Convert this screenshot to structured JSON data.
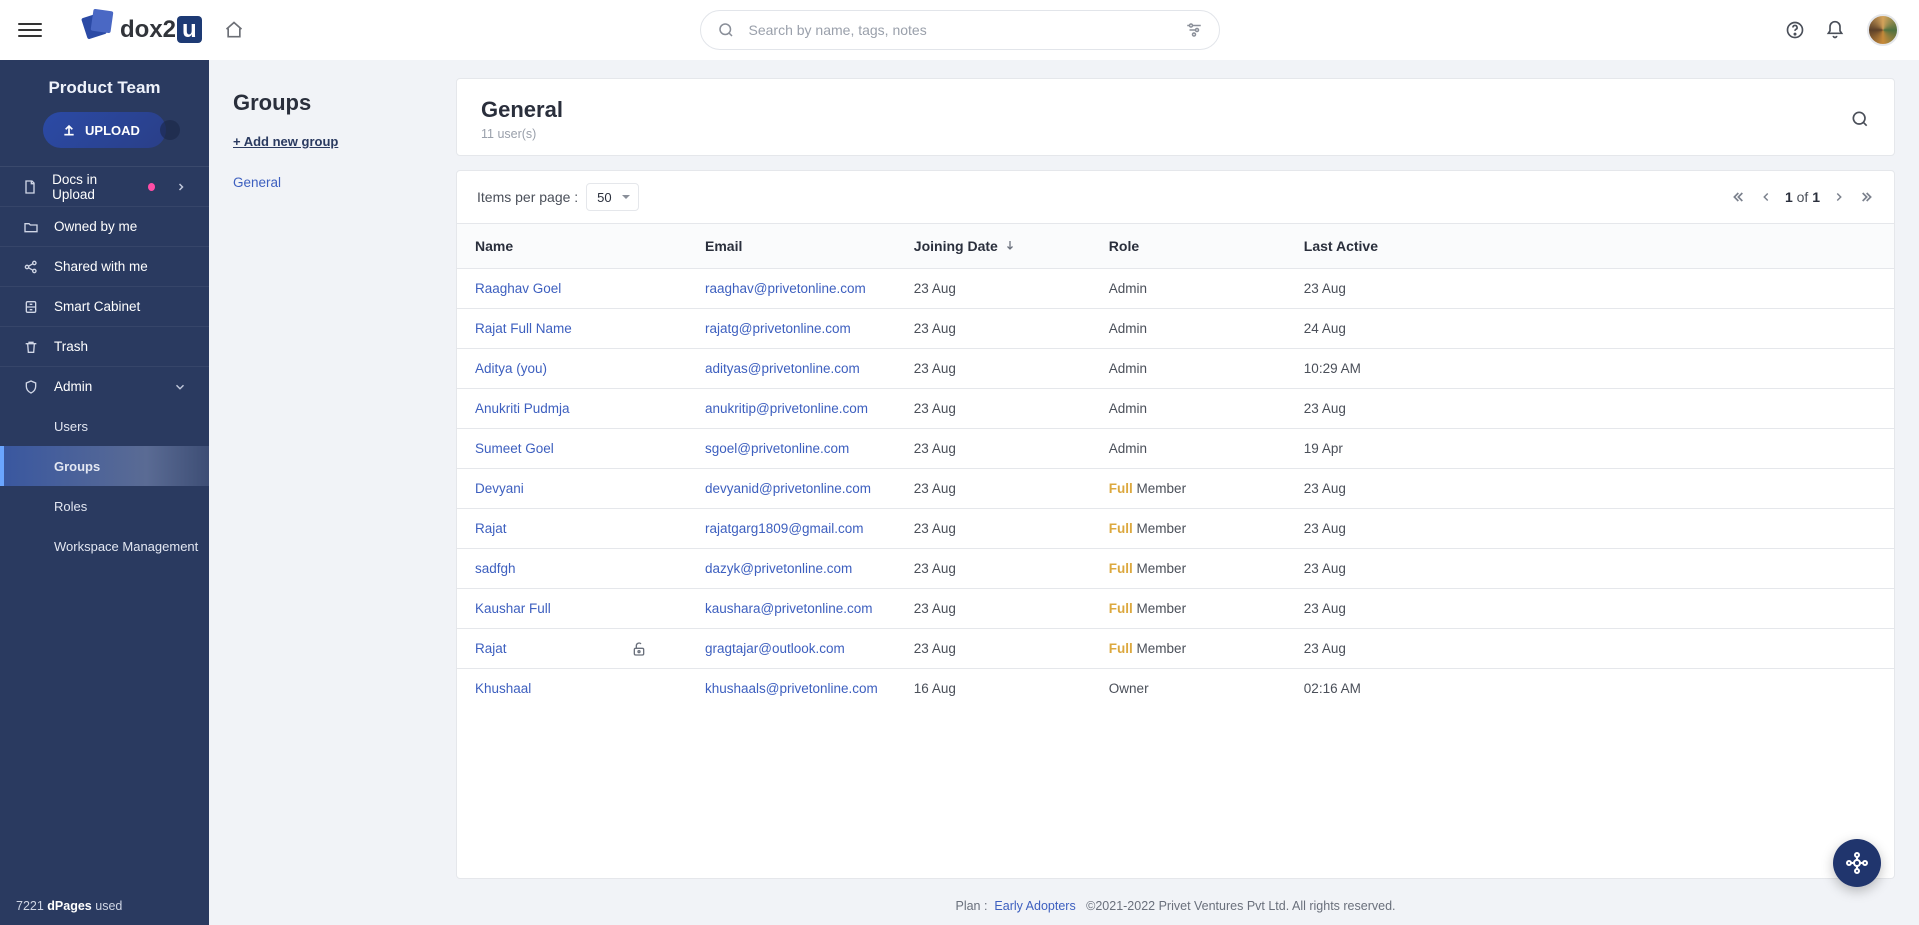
{
  "header": {
    "search_placeholder": "Search by name, tags, notes",
    "logo_prefix": "dox",
    "logo_suffix": "2",
    "logo_box": "u"
  },
  "sidebar": {
    "team": "Product Team",
    "upload_label": "UPLOAD",
    "items": [
      {
        "label": "Docs in Upload"
      },
      {
        "label": "Owned by me"
      },
      {
        "label": "Shared with me"
      },
      {
        "label": "Smart Cabinet"
      },
      {
        "label": "Trash"
      },
      {
        "label": "Admin"
      }
    ],
    "admin_sub": [
      {
        "label": "Users"
      },
      {
        "label": "Groups"
      },
      {
        "label": "Roles"
      },
      {
        "label": "Workspace Management"
      }
    ],
    "footer_count": "7221",
    "footer_unit": "dPages",
    "footer_suffix": "used"
  },
  "groups_panel": {
    "title": "Groups",
    "add_label": "+ Add new group",
    "list": [
      "General"
    ]
  },
  "card": {
    "title": "General",
    "subtitle": "11 user(s)"
  },
  "toolbar": {
    "ipp_label": "Items per page :",
    "ipp_value": "50",
    "page_current": "1",
    "page_of": "of",
    "page_total": "1"
  },
  "columns": {
    "name": "Name",
    "email": "Email",
    "joining": "Joining Date",
    "role": "Role",
    "last_active": "Last Active"
  },
  "rows": [
    {
      "name": "Raaghav Goel",
      "email": "raaghav@privetonline.com",
      "joining": "23 Aug",
      "role": "Admin",
      "last_active": "23 Aug"
    },
    {
      "name": "Rajat Full Name",
      "email": "rajatg@privetonline.com",
      "joining": "23 Aug",
      "role": "Admin",
      "last_active": "24 Aug"
    },
    {
      "name": "Aditya (you)",
      "email": "adityas@privetonline.com",
      "joining": "23 Aug",
      "role": "Admin",
      "last_active": "10:29 AM"
    },
    {
      "name": "Anukriti Pudmja",
      "email": "anukritip@privetonline.com",
      "joining": "23 Aug",
      "role": "Admin",
      "last_active": "23 Aug"
    },
    {
      "name": "Sumeet Goel",
      "email": "sgoel@privetonline.com",
      "joining": "23 Aug",
      "role": "Admin",
      "last_active": "19 Apr"
    },
    {
      "name": "Devyani",
      "email": "devyanid@privetonline.com",
      "joining": "23 Aug",
      "role": "Full Member",
      "role_prefix": "Full",
      "role_suffix": " Member",
      "last_active": "23 Aug"
    },
    {
      "name": "Rajat",
      "email": "rajatgarg1809@gmail.com",
      "joining": "23 Aug",
      "role": "Full Member",
      "role_prefix": "Full",
      "role_suffix": " Member",
      "last_active": "23 Aug"
    },
    {
      "name": "sadfgh",
      "email": "dazyk@privetonline.com",
      "joining": "23 Aug",
      "role": "Full Member",
      "role_prefix": "Full",
      "role_suffix": " Member",
      "last_active": "23 Aug"
    },
    {
      "name": "Kaushar Full",
      "email": "kaushara@privetonline.com",
      "joining": "23 Aug",
      "role": "Full Member",
      "role_prefix": "Full",
      "role_suffix": " Member",
      "last_active": "23 Aug"
    },
    {
      "name": "Rajat",
      "lock": true,
      "email": "gragtajar@outlook.com",
      "joining": "23 Aug",
      "role": "Full Member",
      "role_prefix": "Full",
      "role_suffix": " Member",
      "last_active": "23 Aug"
    },
    {
      "name": "Khushaal",
      "email": "khushaals@privetonline.com",
      "joining": "16 Aug",
      "role": "Owner",
      "last_active": "02:16 AM"
    }
  ],
  "footer": {
    "plan_label": "Plan :",
    "plan_link": "Early Adopters",
    "copyright": "©2021-2022 Privet Ventures Pvt Ltd. All rights reserved."
  }
}
